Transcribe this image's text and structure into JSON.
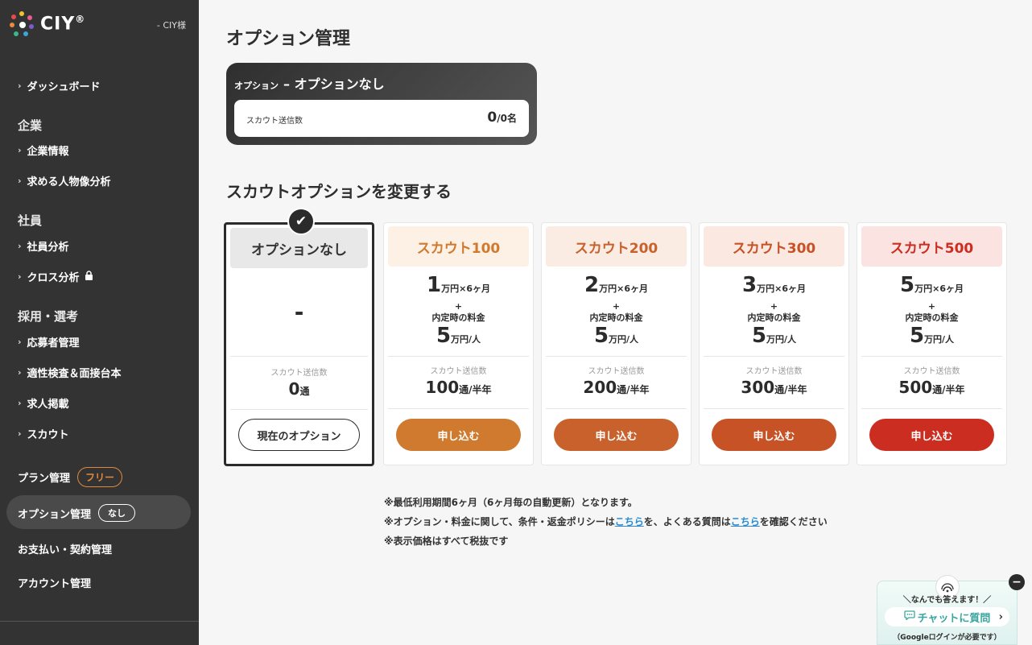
{
  "brand": {
    "logo_text": "CIY",
    "reg": "®",
    "user": "- CIY様"
  },
  "sidebar": {
    "dashboard": "ダッシュボード",
    "section_company": "企業",
    "company_info": "企業情報",
    "persona_analysis": "求める人物像分析",
    "section_employee": "社員",
    "employee_analysis": "社員分析",
    "cross_analysis": "クロス分析",
    "section_recruit": "採用・選考",
    "applicants": "応募者管理",
    "aptitude": "適性検査＆面接台本",
    "job_posting": "求人掲載",
    "scout": "スカウト",
    "plan_mgmt": "プラン管理",
    "plan_badge": "フリー",
    "option_mgmt": "オプション管理",
    "option_badge": "なし",
    "payment": "お支払い・契約管理",
    "account": "アカウント管理"
  },
  "main": {
    "title": "オプション管理",
    "current": {
      "prefix": "オプション",
      "name": "– オプションなし",
      "label": "スカウト送信数",
      "value": "0",
      "suffix": "/0名"
    },
    "change_title": "スカウトオプションを変更する",
    "plans": [
      {
        "title": "オプションなし",
        "dash": "-",
        "sc_label": "スカウト送信数",
        "sc_val": "0",
        "sc_unit": "通",
        "btn": "現在のオプション"
      },
      {
        "title": "スカウト100",
        "base": "1",
        "base_unit": "万円×6ヶ月",
        "plus": "+",
        "fee_label": "内定時の料金",
        "fee": "5",
        "fee_unit": "万円/人",
        "sc_label": "スカウト送信数",
        "sc_val": "100",
        "sc_unit": "通/半年",
        "btn": "申し込む"
      },
      {
        "title": "スカウト200",
        "base": "2",
        "base_unit": "万円×6ヶ月",
        "plus": "+",
        "fee_label": "内定時の料金",
        "fee": "5",
        "fee_unit": "万円/人",
        "sc_label": "スカウト送信数",
        "sc_val": "200",
        "sc_unit": "通/半年",
        "btn": "申し込む"
      },
      {
        "title": "スカウト300",
        "base": "3",
        "base_unit": "万円×6ヶ月",
        "plus": "+",
        "fee_label": "内定時の料金",
        "fee": "5",
        "fee_unit": "万円/人",
        "sc_label": "スカウト送信数",
        "sc_val": "300",
        "sc_unit": "通/半年",
        "btn": "申し込む"
      },
      {
        "title": "スカウト500",
        "base": "5",
        "base_unit": "万円×6ヶ月",
        "plus": "+",
        "fee_label": "内定時の料金",
        "fee": "5",
        "fee_unit": "万円/人",
        "sc_label": "スカウト送信数",
        "sc_val": "500",
        "sc_unit": "通/半年",
        "btn": "申し込む"
      }
    ],
    "notes": {
      "n1": "※最低利用期間6ヶ月（6ヶ月毎の自動更新）となります。",
      "n2a": "※オプション・料金に関して、条件・返金ポリシーは",
      "n2link1": "こちら",
      "n2b": "を、よくある質問は",
      "n2link2": "こちら",
      "n2c": "を確認ください",
      "n3": "※表示価格はすべて税抜です"
    }
  },
  "chat": {
    "line1": "＼なんでも答えます！／",
    "button": "チャットに質問",
    "line3": "（Googleログインが必要です）"
  },
  "colors": {
    "sidebar_bg": "#333333",
    "accent_orange": "#e0893b",
    "plan100_btn": "#cf7a2e",
    "plan200_btn": "#c8612b",
    "plan300_btn": "#c75226",
    "plan500_btn": "#cb2d21",
    "link": "#2a8bd0"
  }
}
